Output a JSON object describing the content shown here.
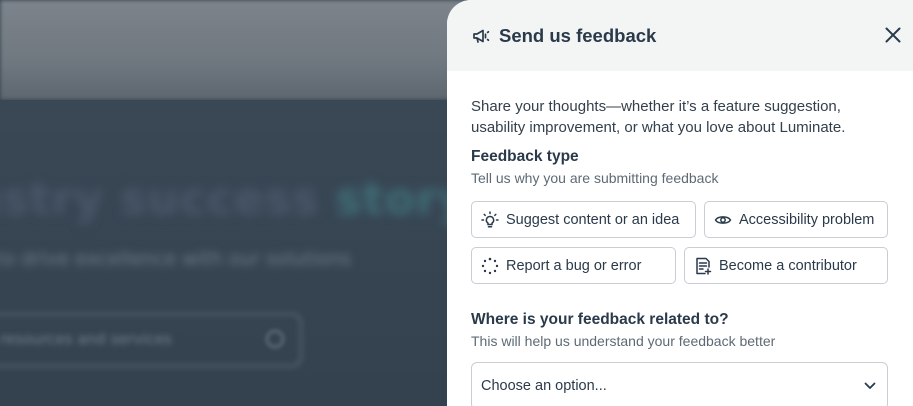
{
  "background": {
    "hero_text_a": "ustry success ",
    "hero_text_b": "story",
    "subtitle": "to drive excellence with our solutions",
    "search_placeholder": "resources and services"
  },
  "panel": {
    "title": "Send us feedback",
    "header_icon": "megaphone-icon",
    "close_icon": "close-icon",
    "intro": "Share your thoughts—whether it’s a feature suggestion, usability improvement, or what you love about Luminate.",
    "feedback_type": {
      "title": "Feedback type",
      "subtitle": "Tell us why you are submitting feedback",
      "options": [
        {
          "label": "Suggest content or an idea",
          "icon": "lightbulb-icon"
        },
        {
          "label": "Accessibility problem",
          "icon": "eye-icon"
        },
        {
          "label": "Report a bug or error",
          "icon": "spinner-dots-icon"
        },
        {
          "label": "Become a contributor",
          "icon": "document-add-icon"
        }
      ]
    },
    "related": {
      "title": "Where is your feedback related to?",
      "subtitle": "This will help us understand your feedback better",
      "select_value": "Choose an option..."
    }
  },
  "colors": {
    "panel_bg": "#ffffff",
    "header_bg": "#f3f4f4",
    "text_primary": "#2a3a4a",
    "border": "#c9ced3"
  }
}
